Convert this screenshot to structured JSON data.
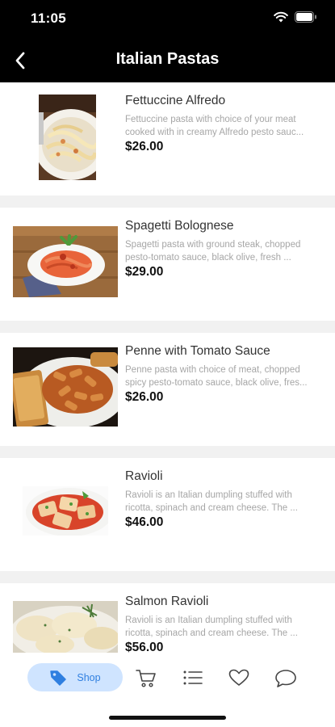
{
  "status_bar": {
    "time": "11:05"
  },
  "header": {
    "title": "Italian Pastas"
  },
  "products": [
    {
      "name": "Fettuccine Alfredo",
      "desc_line1": "Fettuccine pasta with choice of your meat",
      "desc_line2": "cooked with in creamy Alfredo pesto sauc...",
      "price": "$26.00"
    },
    {
      "name": "Spagetti Bolognese",
      "desc_line1": "Spagetti pasta with ground steak, chopped",
      "desc_line2": "pesto-tomato sauce, black olive, fresh ...",
      "price": "$29.00"
    },
    {
      "name": "Penne with Tomato Sauce",
      "desc_line1": "Penne pasta with choice of meat, chopped",
      "desc_line2": "spicy pesto-tomato sauce, black olive, fres...",
      "price": "$26.00"
    },
    {
      "name": "Ravioli",
      "desc_line1": "Ravioli is an Italian dumpling stuffed with",
      "desc_line2": "ricotta, spinach and cream cheese. The ...",
      "price": "$46.00"
    },
    {
      "name": "Salmon Ravioli",
      "desc_line1": "Ravioli is an Italian dumpling stuffed with",
      "desc_line2": "ricotta, spinach and cream cheese. The ...",
      "price": "$56.00"
    }
  ],
  "tab_bar": {
    "shop_label": "Shop",
    "active_tab": "shop",
    "icons": [
      "tag-icon",
      "cart-icon",
      "list-icon",
      "heart-icon",
      "chat-icon"
    ]
  },
  "colors": {
    "header_bg": "#000000",
    "accent": "#2f7fe0",
    "active_tab_bg": "#cfe4ff",
    "description_text": "#a6a6a6",
    "separator": "#f1f1f1"
  }
}
